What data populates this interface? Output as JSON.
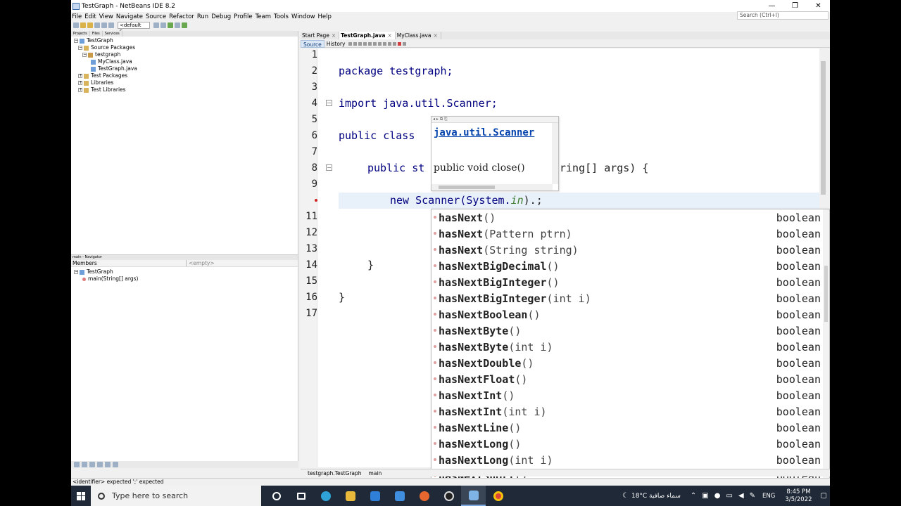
{
  "window": {
    "title": "TestGraph - NetBeans IDE 8.2",
    "controls": [
      "—",
      "❐",
      "✕"
    ]
  },
  "menu": [
    "File",
    "Edit",
    "View",
    "Navigate",
    "Source",
    "Refactor",
    "Run",
    "Debug",
    "Profile",
    "Team",
    "Tools",
    "Window",
    "Help"
  ],
  "search": {
    "placeholder": "Search (Ctrl+I)"
  },
  "toolbar": {
    "config": "<default c..."
  },
  "projects_panel": {
    "tabs": [
      "Projects",
      "Files",
      "Services"
    ],
    "tree": [
      "TestGraph",
      "Source Packages",
      "testgraph",
      "MyClass.java",
      "TestGraph.java",
      "Test Packages",
      "Libraries",
      "Test Libraries"
    ]
  },
  "navigator": {
    "header": "main - Navigator",
    "members_label": "Members",
    "filter_value": "<empty>",
    "tree": [
      "TestGraph",
      "main(String[] args)"
    ]
  },
  "editor": {
    "tabs": [
      {
        "label": "Start Page",
        "active": false
      },
      {
        "label": "TestGraph.java",
        "active": true
      },
      {
        "label": "MyClass.java",
        "active": false
      }
    ],
    "view_tabs": [
      "Source",
      "History"
    ],
    "line_numbers": [
      "1",
      "2",
      "3",
      "4",
      "5",
      "6",
      "7",
      "8",
      "9",
      "11",
      "12",
      "13",
      "14",
      "15",
      "16",
      "17"
    ],
    "code": {
      "l2": "package testgraph;",
      "l4": "import java.util.Scanner;",
      "l6": "public class",
      "l8a": "public st",
      "l8b": "ring[] args) {",
      "l10a": "new Scanner(System.",
      "l10b": "in",
      "l10c": ").;",
      "l14": "}",
      "l16": "}"
    },
    "breadcrumb": [
      "testgraph.TestGraph",
      "main"
    ]
  },
  "doc_popup": {
    "package": "java.util.Scanner",
    "signature": "public void close()"
  },
  "completion": [
    {
      "name": "hasNext",
      "params": "()",
      "ret": "boolean"
    },
    {
      "name": "hasNext",
      "params": "(Pattern ptrn)",
      "ret": "boolean"
    },
    {
      "name": "hasNext",
      "params": "(String string)",
      "ret": "boolean"
    },
    {
      "name": "hasNextBigDecimal",
      "params": "()",
      "ret": "boolean"
    },
    {
      "name": "hasNextBigInteger",
      "params": "()",
      "ret": "boolean"
    },
    {
      "name": "hasNextBigInteger",
      "params": "(int i)",
      "ret": "boolean"
    },
    {
      "name": "hasNextBoolean",
      "params": "()",
      "ret": "boolean"
    },
    {
      "name": "hasNextByte",
      "params": "()",
      "ret": "boolean"
    },
    {
      "name": "hasNextByte",
      "params": "(int i)",
      "ret": "boolean"
    },
    {
      "name": "hasNextDouble",
      "params": "()",
      "ret": "boolean"
    },
    {
      "name": "hasNextFloat",
      "params": "()",
      "ret": "boolean"
    },
    {
      "name": "hasNextInt",
      "params": "()",
      "ret": "boolean"
    },
    {
      "name": "hasNextInt",
      "params": "(int i)",
      "ret": "boolean"
    },
    {
      "name": "hasNextLine",
      "params": "()",
      "ret": "boolean"
    },
    {
      "name": "hasNextLong",
      "params": "()",
      "ret": "boolean"
    },
    {
      "name": "hasNextLong",
      "params": "(int i)",
      "ret": "boolean"
    },
    {
      "name": "hasNextShort",
      "params": "()",
      "ret": "boolean"
    }
  ],
  "status_bar": {
    "message": "<identifier> expected   ';' expected"
  },
  "taskbar": {
    "search_placeholder": "Type here to search",
    "weather": "18°C  سماء صافية",
    "language": "ENG",
    "time": "8:45 PM",
    "date": "3/5/2022"
  }
}
